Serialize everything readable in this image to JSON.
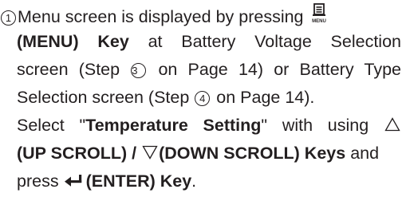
{
  "instruction": {
    "step_marker": "1",
    "line1": "Menu screen is displayed by pressing",
    "menu_icon_label": "MENU",
    "menu_key": "(MENU) Key",
    "line2_after_key": "at Battery Voltage Selection",
    "line3_a": "screen (Step",
    "step_ref_a": "3",
    "line3_b": "on Page 14) or Battery Type",
    "line4_a": "Selection screen (Step",
    "step_ref_b": "4",
    "line4_b": "on Page 14).",
    "line5_a": "Select \"",
    "setting_name": "Temperature Setting",
    "line5_b": "\" with using",
    "up_scroll_key": "(UP SCROLL) /",
    "down_scroll_key": "(DOWN SCROLL) Keys",
    "line6_b": "and",
    "line7_a": "press",
    "enter_key": "(ENTER) Key",
    "line7_end": "."
  }
}
